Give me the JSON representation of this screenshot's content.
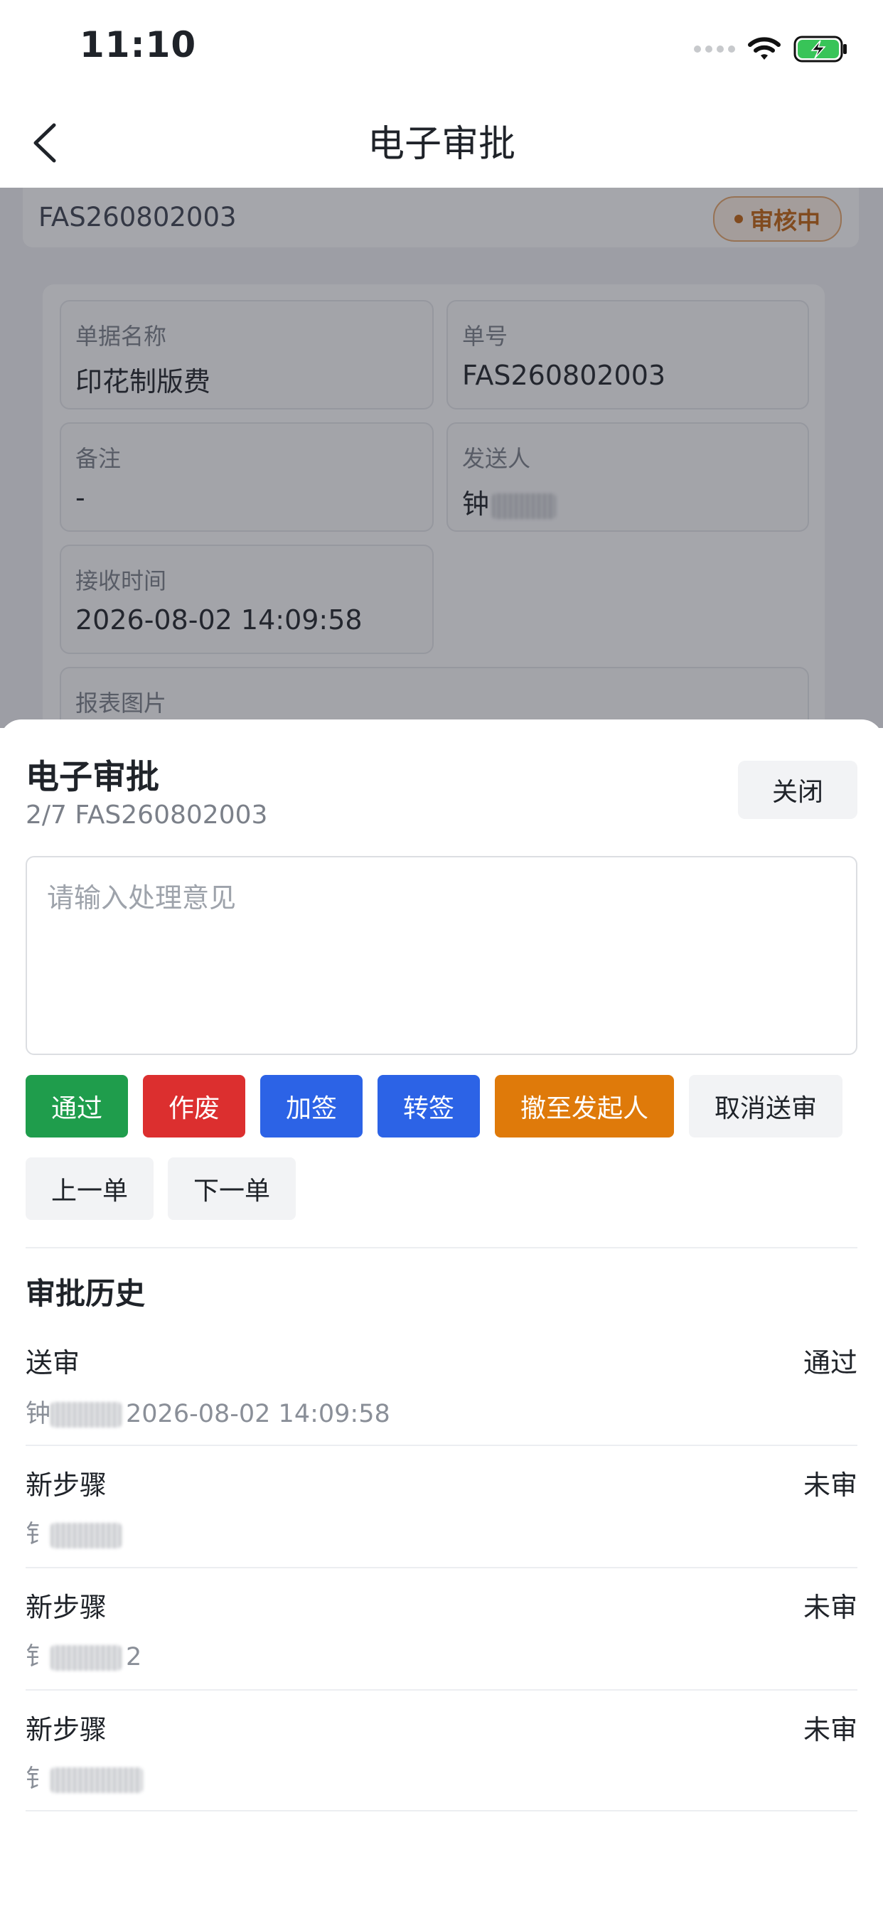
{
  "status_bar": {
    "time": "11:10"
  },
  "nav": {
    "title": "电子审批"
  },
  "document": {
    "number": "FAS260802003",
    "status": "审核中",
    "fields": [
      {
        "label": "单据名称",
        "value": "印花制版费"
      },
      {
        "label": "单号",
        "value": "FAS260802003"
      },
      {
        "label": "备注",
        "value": "-"
      },
      {
        "label": "发送人",
        "value": "钟"
      },
      {
        "label": "接收时间",
        "value": "2026-08-02 14:09:58"
      },
      {
        "label": "报表图片",
        "value": ""
      }
    ]
  },
  "sheet": {
    "title": "电子审批",
    "subtitle": "2/7 FAS260802003",
    "close_label": "关闭",
    "comment_placeholder": "请输入处理意见",
    "actions": [
      {
        "label": "通过",
        "color": "#1f9d4c"
      },
      {
        "label": "作废",
        "color": "#dc2f2f"
      },
      {
        "label": "加签",
        "color": "#2c63e6"
      },
      {
        "label": "转签",
        "color": "#2c63e6"
      },
      {
        "label": "撤至发起人",
        "color": "#df7a0a"
      },
      {
        "label": "取消送审",
        "color": "#f2f3f5"
      }
    ],
    "prev_label": "上一单",
    "next_label": "下一单"
  },
  "history": {
    "title": "审批历史",
    "steps": [
      {
        "name": "送审",
        "status": "通过",
        "meta_prefix": "钟",
        "meta_text": "2026-08-02 14:09:58"
      },
      {
        "name": "新步骤",
        "status": "未审",
        "meta_prefix": "钅",
        "meta_text": ""
      },
      {
        "name": "新步骤",
        "status": "未审",
        "meta_prefix": "钅",
        "meta_text": "2"
      },
      {
        "name": "新步骤",
        "status": "未审",
        "meta_prefix": "钅",
        "meta_text": ""
      }
    ]
  }
}
